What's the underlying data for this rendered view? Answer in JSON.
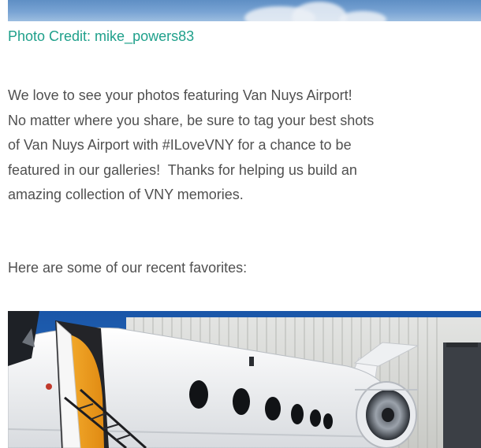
{
  "credit": {
    "text": "Photo Credit: mike_powers83",
    "color": "#1fa08b"
  },
  "body": {
    "lines": [
      "We love to see your photos featuring Van Nuys Airport!",
      "No matter where you share, be sure to tag your best shots",
      "of Van Nuys Airport with #ILoveVNY for a chance to be",
      "featured in our galleries!  Thanks for helping us build an",
      "amazing collection of VNY memories."
    ],
    "favorites": "Here are some of our recent favorites:"
  },
  "colors": {
    "text": "#505050",
    "link": "#1fa08b",
    "sky": "#1f63b8"
  }
}
